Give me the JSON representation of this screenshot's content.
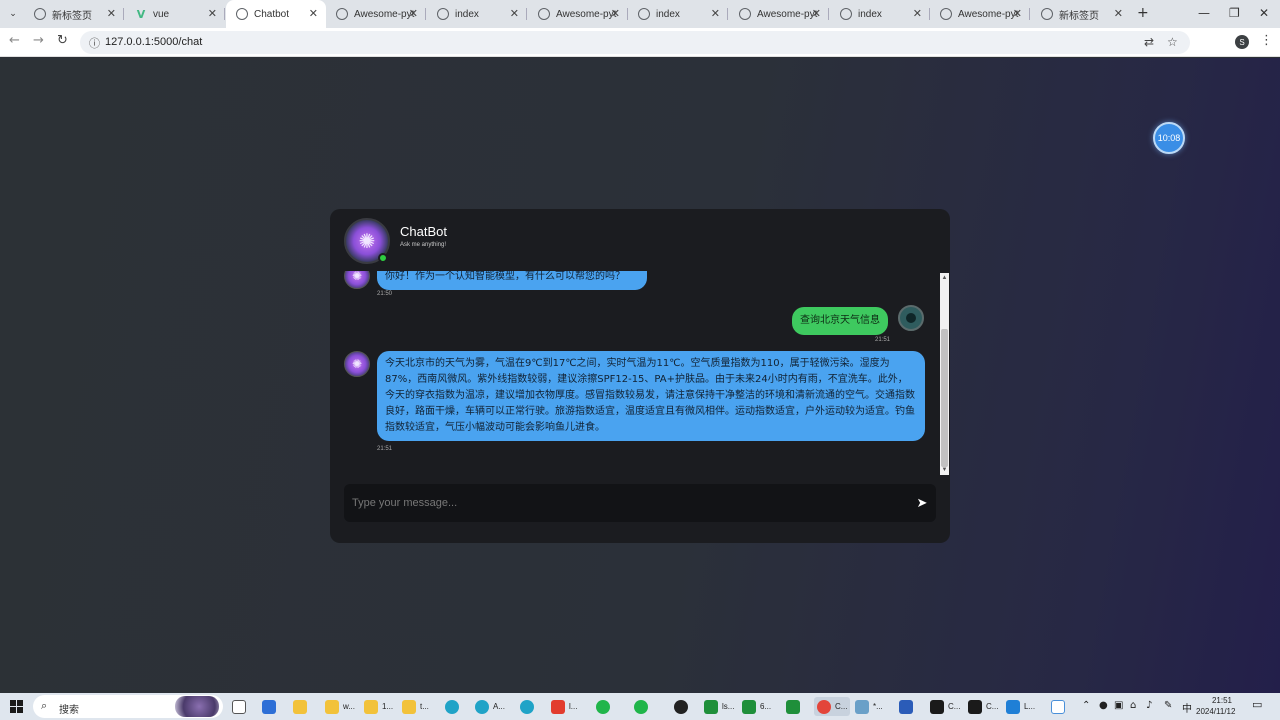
{
  "browser": {
    "tabs": [
      {
        "title": "新标签页",
        "icon": "globe-icon",
        "active": false
      },
      {
        "title": "vue",
        "icon": "vue-icon",
        "active": false
      },
      {
        "title": "Chatbot",
        "icon": "globe-icon",
        "active": true
      },
      {
        "title": "Awesome-pyt",
        "icon": "globe-icon",
        "active": false
      },
      {
        "title": "index",
        "icon": "globe-icon",
        "active": false
      },
      {
        "title": "Awesome-pyt",
        "icon": "globe-icon",
        "active": false
      },
      {
        "title": "index",
        "icon": "globe-icon",
        "active": false
      },
      {
        "title": "Awesome-pyt",
        "icon": "globe-icon",
        "active": false
      },
      {
        "title": "index",
        "icon": "globe-icon",
        "active": false
      },
      {
        "title": "Awesome-pyt",
        "icon": "globe-icon",
        "active": false
      },
      {
        "title": "新标签页",
        "icon": "globe-icon",
        "active": false
      }
    ],
    "url": "127.0.0.1:5000/chat",
    "profile_initial": "S"
  },
  "page": {
    "clock_badge": "10:08"
  },
  "chat": {
    "bot_name": "ChatBot",
    "bot_subtitle": "Ask me anything!",
    "messages": [
      {
        "sender": "bot",
        "text": "你好！作为一个认知智能模型，有什么可以帮您的吗？",
        "time": "21:50"
      },
      {
        "sender": "user",
        "text": "查询北京天气信息",
        "time": "21:51"
      },
      {
        "sender": "bot",
        "text": "今天北京市的天气为雾，气温在9℃到17℃之间，实时气温为11℃。空气质量指数为110，属于轻微污染。湿度为87%，西南风微风。紫外线指数较弱，建议涂擦SPF12-15、PA+护肤品。由于未来24小时内有雨，不宜洗车。此外，今天的穿衣指数为温凉，建议增加衣物厚度。感冒指数较易发，请注意保持干净整洁的环境和清新流通的空气。交通指数良好，路面干燥，车辆可以正常行驶。旅游指数适宜，温度适宜且有微风相伴。运动指数适宜，户外运动较为适宜。钓鱼指数较适宜，气压小幅波动可能会影响鱼儿进食。",
        "time": "21:51"
      }
    ],
    "input_placeholder": "Type your message..."
  },
  "taskbar": {
    "search_label": "搜索",
    "apps": [
      "w...",
      "1...",
      "t...",
      "A...",
      "l...",
      "ls...",
      "6...",
      "C...",
      "*...",
      "C...",
      "C...",
      "L..."
    ],
    "ime": "中",
    "time": "21:51",
    "date": "2024/11/12"
  }
}
